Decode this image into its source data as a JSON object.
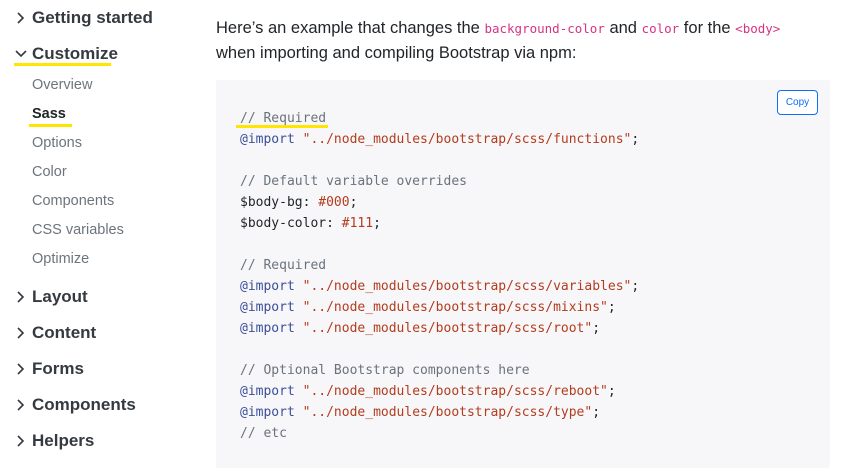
{
  "sidebar": {
    "sections": [
      {
        "label": "Getting started",
        "expanded": false
      },
      {
        "label": "Customize",
        "expanded": true
      },
      {
        "label": "Layout",
        "expanded": false
      },
      {
        "label": "Content",
        "expanded": false
      },
      {
        "label": "Forms",
        "expanded": false
      },
      {
        "label": "Components",
        "expanded": false
      },
      {
        "label": "Helpers",
        "expanded": false
      }
    ],
    "customize_items": [
      "Overview",
      "Sass",
      "Options",
      "Color",
      "Components",
      "CSS variables",
      "Optimize"
    ],
    "active_item": "Sass"
  },
  "main": {
    "intro_pre": "Here’s an example that changes the ",
    "code1": "background-color",
    "intro_and": " and ",
    "code2": "color",
    "intro_for": " for the ",
    "code3": "<body>",
    "intro_line2": "when importing and compiling Bootstrap via npm:"
  },
  "codeblock": {
    "copy_label": "Copy",
    "lines": [
      {
        "type": "comment",
        "text": "// Required"
      },
      {
        "type": "import",
        "kw": "@import",
        "str": "\"../node_modules/bootstrap/scss/functions\"",
        "end": ";"
      },
      {
        "type": "blank"
      },
      {
        "type": "comment",
        "text": "// Default variable overrides"
      },
      {
        "type": "var",
        "name": "$body-bg",
        "sep": ": ",
        "value": "#000",
        "end": ";"
      },
      {
        "type": "var",
        "name": "$body-color",
        "sep": ": ",
        "value": "#111",
        "end": ";"
      },
      {
        "type": "blank"
      },
      {
        "type": "comment",
        "text": "// Required"
      },
      {
        "type": "import",
        "kw": "@import",
        "str": "\"../node_modules/bootstrap/scss/variables\"",
        "end": ";"
      },
      {
        "type": "import",
        "kw": "@import",
        "str": "\"../node_modules/bootstrap/scss/mixins\"",
        "end": ";"
      },
      {
        "type": "import",
        "kw": "@import",
        "str": "\"../node_modules/bootstrap/scss/root\"",
        "end": ";"
      },
      {
        "type": "blank"
      },
      {
        "type": "comment",
        "text": "// Optional Bootstrap components here"
      },
      {
        "type": "import",
        "kw": "@import",
        "str": "\"../node_modules/bootstrap/scss/reboot\"",
        "end": ";"
      },
      {
        "type": "import",
        "kw": "@import",
        "str": "\"../node_modules/bootstrap/scss/type\"",
        "end": ";"
      },
      {
        "type": "comment",
        "text": "// etc"
      }
    ]
  },
  "colors": {
    "highlight": "#ffe500",
    "link_blue": "#0d6efd",
    "inline_code": "#d63384",
    "code_bg": "#f7f7f9"
  }
}
